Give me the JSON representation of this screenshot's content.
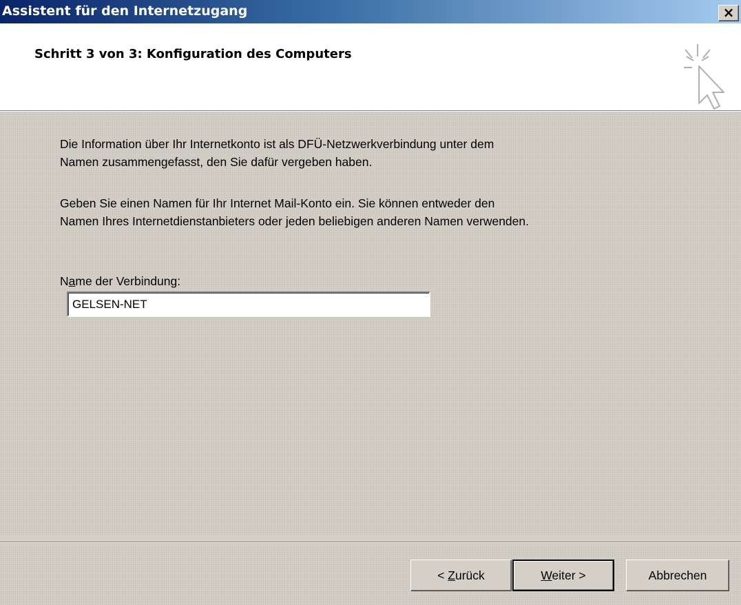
{
  "window": {
    "title": "Assistent für den Internetzugang",
    "close_symbol": "×"
  },
  "header": {
    "step_title": "Schritt  3 von 3: Konfiguration des Computers",
    "icon": "wizard-cursor-icon"
  },
  "content": {
    "paragraph1_line1": "Die Information über Ihr Internetkonto ist als DFÜ-Netzwerkverbindung unter dem",
    "paragraph1_line2": "Namen zusammengefasst, den Sie dafür vergeben haben.",
    "paragraph2_line1": "Geben Sie einen Namen für Ihr Internet Mail-Konto ein. Sie können entweder den",
    "paragraph2_line2": "Namen Ihres Internetdienstanbieters oder jeden beliebigen anderen Namen verwenden.",
    "field_label_pre": "N",
    "field_label_accel": "a",
    "field_label_post": "me der Verbindung:",
    "connection_name_value": "GELSEN-NET"
  },
  "buttons": {
    "back_pre": "< ",
    "back_accel": "Z",
    "back_post": "urück",
    "next_accel": "W",
    "next_post": "eiter >",
    "cancel": "Abbrechen"
  }
}
